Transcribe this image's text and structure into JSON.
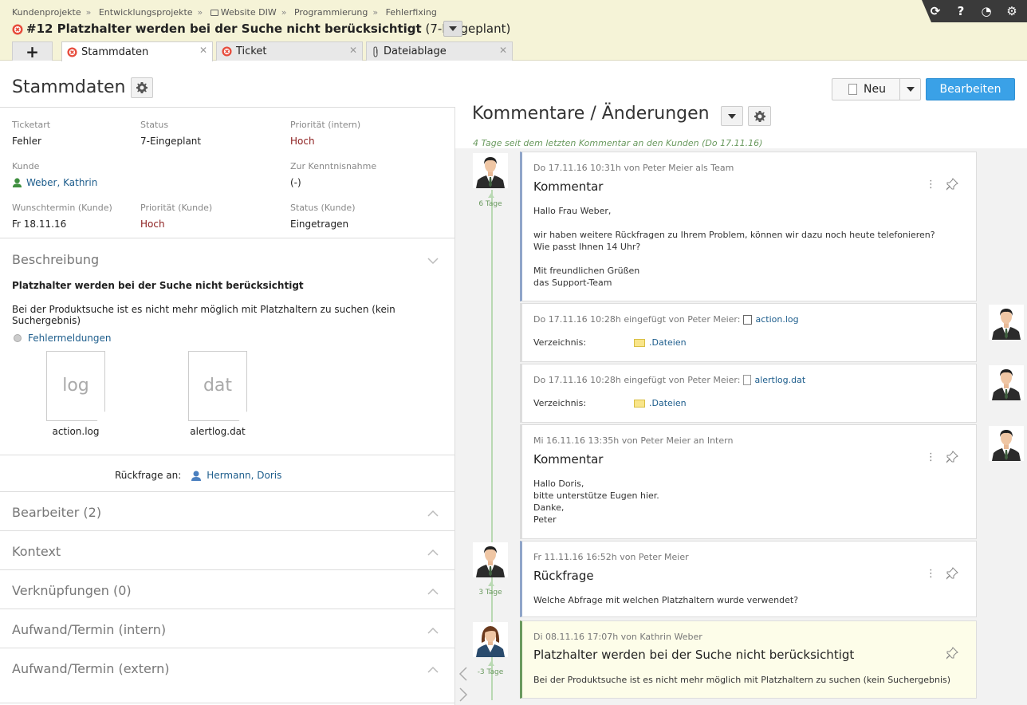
{
  "breadcrumb": [
    "Kundenprojekte",
    "Entwicklungsprojekte",
    "Website DIW",
    "Programmierung",
    "Fehlerfixing"
  ],
  "ticket": {
    "title": "#12 Platzhalter werden bei der Suche nicht berücksichtigt",
    "status": "(7-Eingeplant)"
  },
  "tabs": {
    "stamm": "Stammdaten",
    "ticket": "Ticket",
    "datei": "Dateiablage"
  },
  "toolbar": {
    "help": "?"
  },
  "left": {
    "title": "Stammdaten",
    "fields": {
      "ticketart": {
        "label": "Ticketart",
        "value": "Fehler"
      },
      "status": {
        "label": "Status",
        "value": "7-Eingeplant"
      },
      "prio_intern": {
        "label": "Priorität (intern)",
        "value": "Hoch"
      },
      "kunde": {
        "label": "Kunde",
        "value": "Weber, Kathrin"
      },
      "kenntnis": {
        "label": "Zur Kenntnisnahme",
        "value": "(-)"
      },
      "wunsch": {
        "label": "Wunschtermin (Kunde)",
        "value": "Fr 18.11.16"
      },
      "prio_kunde": {
        "label": "Priorität (Kunde)",
        "value": "Hoch"
      },
      "status_kunde": {
        "label": "Status (Kunde)",
        "value": "Eingetragen"
      }
    },
    "beschreibung": {
      "label": "Beschreibung",
      "heading": "Platzhalter werden bei der Suche nicht berücksichtigt",
      "text": "Bei der Produktsuche ist es nicht mehr möglich mit Platzhaltern zu suchen (kein Suchergebnis)",
      "errors_label": "Fehlermeldungen",
      "files": [
        {
          "ext": "log",
          "name": "action.log"
        },
        {
          "ext": "dat",
          "name": "alertlog.dat"
        }
      ]
    },
    "rueckfrage": {
      "label": "Rückfrage an:",
      "person": "Hermann, Doris"
    },
    "sections": [
      "Bearbeiter (2)",
      "Kontext",
      "Verknüpfungen (0)",
      "Aufwand/Termin (intern)",
      "Aufwand/Termin (extern)"
    ]
  },
  "right": {
    "title": "Kommentare / Änderungen",
    "since": "4 Tage seit dem letzten Kommentar an den Kunden (Do 17.11.16)",
    "btn_neu": "Neu",
    "btn_edit": "Bearbeiten",
    "dir_label": "Verzeichnis:",
    "dir_value": ".Dateien",
    "entries": [
      {
        "meta": "Do 17.11.16 10:31h von Peter Meier als Team",
        "title": "Kommentar",
        "body": "Hallo Frau Weber,\n\nwir haben weitere Rückfragen zu Ihrem Problem, können wir dazu noch heute telefonieren?\nWie passt Ihnen 14 Uhr?\n\nMit freundlichen Grüßen\ndas Support-Team",
        "days": "6 Tage"
      },
      {
        "meta": "Do 17.11.16 10:28h eingefügt von Peter Meier:",
        "file": "action.log"
      },
      {
        "meta": "Do 17.11.16 10:28h eingefügt von Peter Meier:",
        "file": "alertlog.dat"
      },
      {
        "meta": "Mi 16.11.16 13:35h von Peter Meier an Intern",
        "title": "Kommentar",
        "body": "Hallo Doris,\nbitte unterstütze Eugen hier.\nDanke,\nPeter"
      },
      {
        "meta": "Fr 11.11.16 16:52h von Peter Meier",
        "title": "Rückfrage",
        "body": "Welche Abfrage mit welchen Platzhaltern wurde verwendet?",
        "days": "3 Tage"
      },
      {
        "meta": "Di 08.11.16 17:07h von Kathrin Weber",
        "title": "Platzhalter werden bei der Suche nicht berücksichtigt",
        "body": "Bei der Produktsuche ist es nicht mehr möglich mit Platzhaltern zu suchen (kein Suchergebnis)",
        "days": "-3 Tage"
      }
    ]
  },
  "colors": {
    "accent": "#3aa1e7",
    "header_bg": "#f5f3d7",
    "priority": "#8b1c1c",
    "link": "#1d5d8c",
    "timeline": "#6a9a5f"
  }
}
